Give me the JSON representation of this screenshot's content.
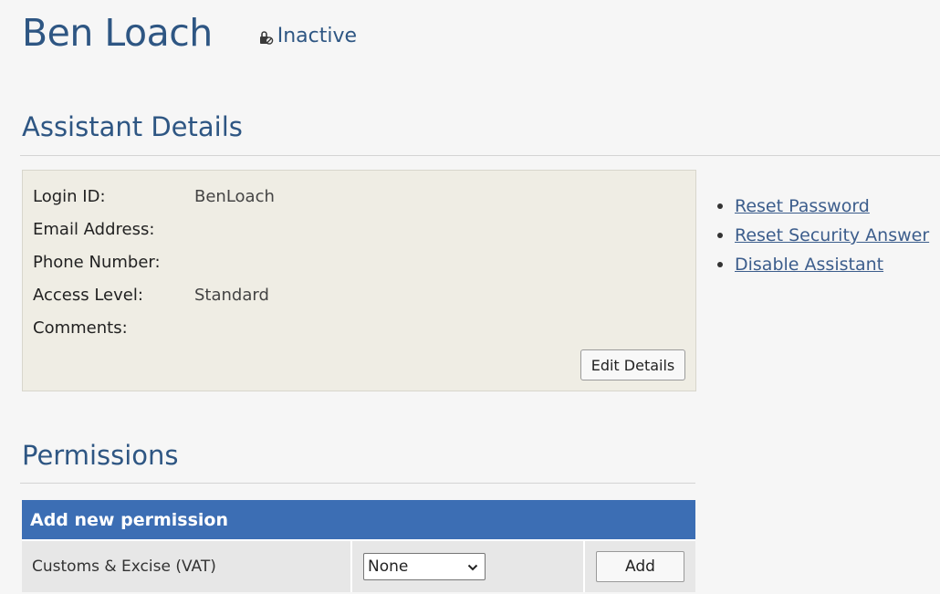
{
  "user": {
    "name": "Ben Loach",
    "status": "Inactive"
  },
  "details": {
    "title": "Assistant Details",
    "fields": [
      {
        "label": "Login ID:",
        "value": "BenLoach"
      },
      {
        "label": "Email Address:",
        "value": ""
      },
      {
        "label": "Phone Number:",
        "value": ""
      },
      {
        "label": "Access Level:",
        "value": "Standard"
      },
      {
        "label": "Comments:",
        "value": ""
      }
    ],
    "edit_label": "Edit Details"
  },
  "actions": [
    "Reset Password",
    "Reset Security Answer",
    "Disable Assistant"
  ],
  "permissions": {
    "title": "Permissions",
    "table_header": "Add new permission",
    "row": {
      "name": "Customs & Excise (VAT)",
      "selected": "None",
      "add_label": "Add"
    }
  },
  "icons": {
    "status": "lock-icon",
    "select": "chevron-down-icon"
  },
  "colors": {
    "heading": "#2e5683",
    "link": "#3c5d8c",
    "table_header": "#3c6eb4",
    "details_bg": "#efede4"
  }
}
